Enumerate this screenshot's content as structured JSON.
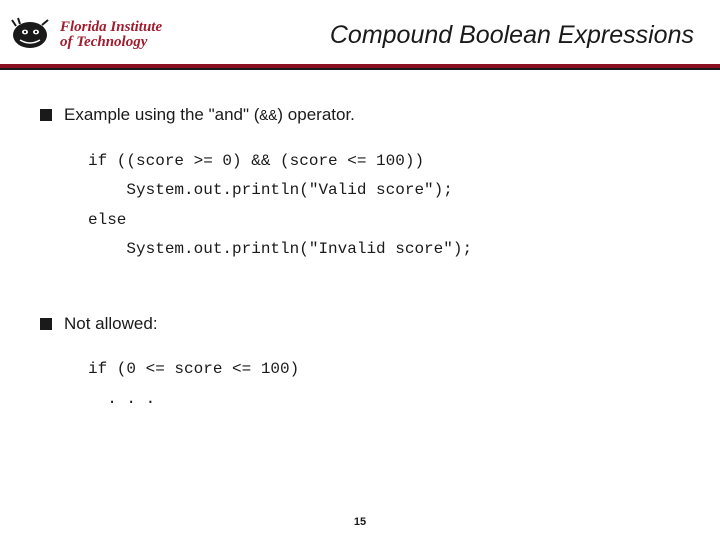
{
  "header": {
    "logo_line1": "Florida Institute",
    "logo_line2": "of Technology",
    "title": "Compound Boolean Expressions"
  },
  "bullets": [
    {
      "prefix": "Example using the \"and\" (",
      "mono": "&&",
      "suffix": ") operator."
    },
    {
      "prefix": "Not allowed:",
      "mono": "",
      "suffix": ""
    }
  ],
  "code1": "if ((score >= 0) && (score <= 100))\n    System.out.println(\"Valid score\");\nelse\n    System.out.println(\"Invalid score\");",
  "code2": "if (0 <= score <= 100)\n  . . .",
  "page_number": "15"
}
